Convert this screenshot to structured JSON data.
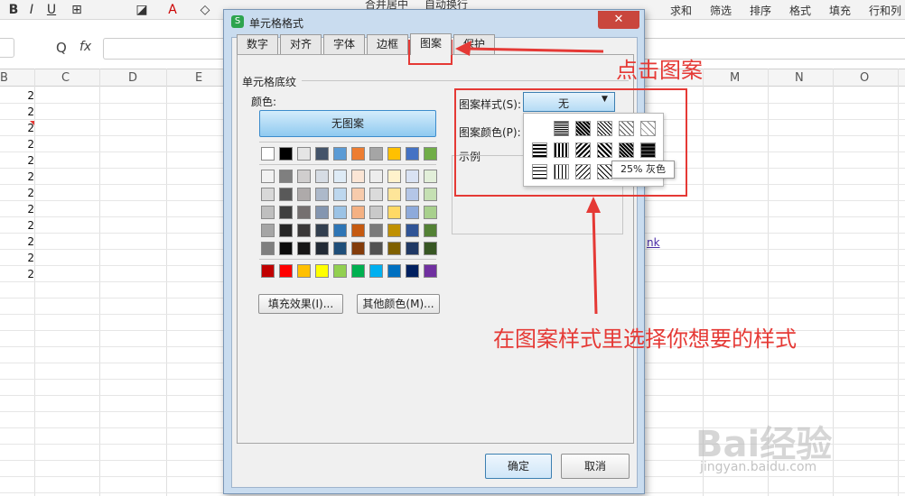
{
  "toolbar": {
    "bold": "B",
    "italic": "I",
    "underline": "U",
    "merge": "合并居中",
    "wrap": "自动换行",
    "sum": "求和",
    "filter": "筛选",
    "sort": "排序",
    "format": "格式",
    "fill": "填充",
    "rowcol": "行和列"
  },
  "formula": {
    "zoom_icon": "Q",
    "fx": "fx"
  },
  "grid": {
    "columns": [
      "B",
      "C",
      "D",
      "E",
      "M",
      "N",
      "O"
    ],
    "values": [
      "2",
      "2",
      "2",
      "2",
      "2",
      "2",
      "2",
      "2",
      "2",
      "2",
      "2",
      "2"
    ],
    "link_fragment": "nk"
  },
  "dialog": {
    "title": "单元格格式",
    "tabs": [
      "数字",
      "对齐",
      "字体",
      "边框",
      "图案",
      "保护"
    ],
    "section_label": "单元格底纹",
    "color_label": "颜色:",
    "no_pattern": "无图案",
    "fill_effects": "填充效果(I)...",
    "more_colors": "其他颜色(M)...",
    "pattern_style_label": "图案样式(S):",
    "pattern_style_value": "无",
    "pattern_color_label": "图案颜色(P):",
    "sample_label": "示例",
    "tooltip": "25% 灰色",
    "ok": "确定",
    "cancel": "取消"
  },
  "annotations": {
    "click_pattern": "点击图案",
    "choose_style": "在图案样式里选择你想要的样式"
  },
  "watermark": {
    "text": "Bai经验",
    "url": "jingyan.baidu.com"
  },
  "colors": {
    "row1": [
      "#ffffff",
      "#000000",
      "#e5e5e5",
      "#44546a",
      "#5b9bd5",
      "#ed7d31",
      "#a5a5a5",
      "#ffc000",
      "#4472c4",
      "#70ad47"
    ],
    "row2": [
      "#f2f2f2",
      "#7f7f7f",
      "#d0cece",
      "#d6dce4",
      "#deebf6",
      "#fbe5d5",
      "#ededed",
      "#fff2cc",
      "#d9e2f3",
      "#e2efd9"
    ],
    "row3": [
      "#d8d8d8",
      "#595959",
      "#aeaaaa",
      "#adb9ca",
      "#bdd7ee",
      "#f7cbac",
      "#dbdbdb",
      "#fee599",
      "#b4c6e7",
      "#c5e0b3"
    ],
    "row4": [
      "#bfbfbf",
      "#3f3f3f",
      "#757070",
      "#8496b0",
      "#9cc3e5",
      "#f4b183",
      "#c9c9c9",
      "#ffd965",
      "#8eaadb",
      "#a8d08d"
    ],
    "row5": [
      "#a5a5a5",
      "#262626",
      "#3a3838",
      "#323f4f",
      "#2e75b5",
      "#c55a11",
      "#7b7b7b",
      "#bf9000",
      "#2f5496",
      "#538135"
    ],
    "row6": [
      "#7f7f7f",
      "#0c0c0c",
      "#171616",
      "#222a35",
      "#1e4e79",
      "#833c0b",
      "#525252",
      "#7f6000",
      "#1f3864",
      "#375623"
    ],
    "standard": [
      "#c00000",
      "#ff0000",
      "#ffc000",
      "#ffff00",
      "#92d050",
      "#00b050",
      "#00b0f0",
      "#0070c0",
      "#002060",
      "#7030a0"
    ],
    "accent": "#e53935"
  }
}
